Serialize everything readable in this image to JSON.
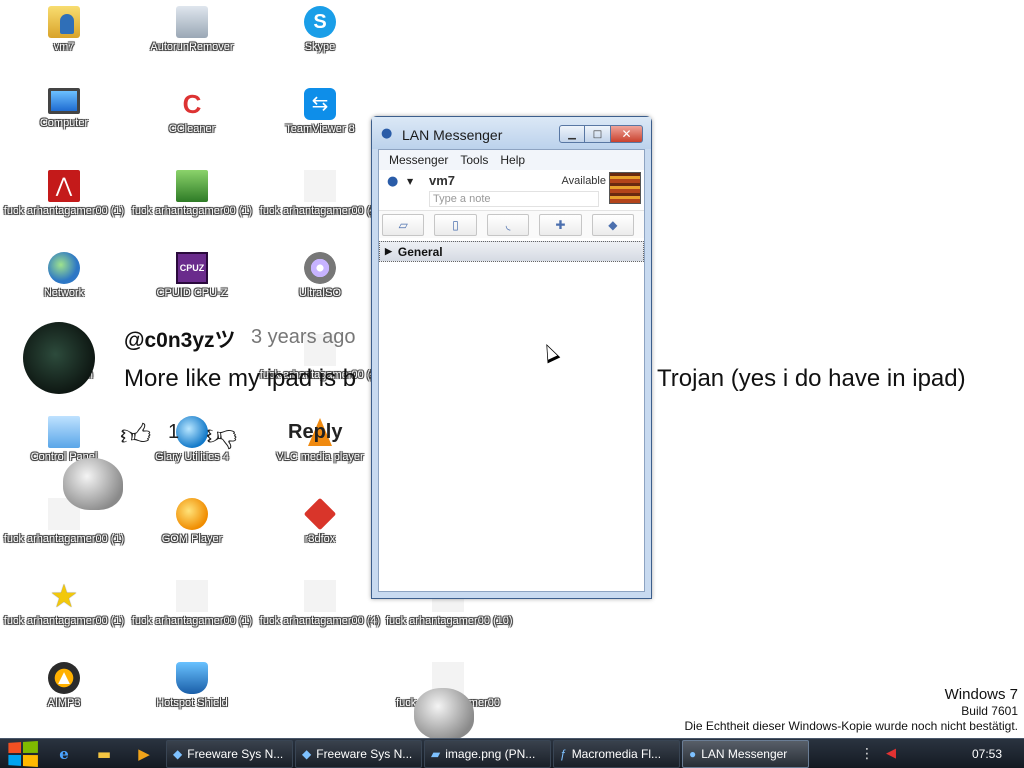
{
  "desktop_icons": [
    {
      "label": "vm7",
      "icon": "user-folder-icon"
    },
    {
      "label": "AutorunRemover",
      "icon": "autorun-remover-icon"
    },
    {
      "label": "Skype",
      "icon": "skype-icon",
      "glyph": "S"
    },
    {
      "label": "Computer",
      "icon": "computer-icon"
    },
    {
      "label": "CCleaner",
      "icon": "ccleaner-icon",
      "glyph": "C"
    },
    {
      "label": "TeamViewer 8",
      "icon": "teamviewer-icon",
      "glyph": "⇆"
    },
    {
      "label": "fuck arhantagamer00 (1)",
      "icon": "pdf-icon",
      "glyph": "⋀"
    },
    {
      "label": "fuck arhantagamer00 (1)",
      "icon": "script-icon"
    },
    {
      "label": "fuck arhantagamer00 (2)",
      "icon": "blank-file-icon"
    },
    {
      "label": "Network",
      "icon": "network-icon"
    },
    {
      "label": "CPUID CPU-Z",
      "icon": "cpuz-icon",
      "glyph": "CPUZ"
    },
    {
      "label": "UltraISO",
      "icon": "ultraiso-icon"
    },
    {
      "label": "Recycle Bin",
      "icon": "recycle-bin-icon"
    },
    {
      "label": "fuck arhantagamer00 (3)",
      "icon": "blank-file-icon"
    },
    {
      "label": "Control Panel",
      "icon": "control-panel-icon"
    },
    {
      "label": "Glary Utilities 4",
      "icon": "glary-utilities-icon"
    },
    {
      "label": "VLC media player",
      "icon": "vlc-icon"
    },
    {
      "label": "fuck arhantagamer00 (1)",
      "icon": "blank-file-icon"
    },
    {
      "label": "GOM Player",
      "icon": "gom-player-icon"
    },
    {
      "label": "r3dfox",
      "icon": "r3dfox-icon"
    },
    {
      "label": "fuck arhantagamer00 (1)",
      "icon": "star-icon",
      "glyph": "★"
    },
    {
      "label": "fuck arhantagamer00 (1)",
      "icon": "blank-file-icon"
    },
    {
      "label": "fuck arhantagamer00 (4)",
      "icon": "blank-file-icon"
    },
    {
      "label": "fuck arhantagamer00 (10)",
      "icon": "blank-file-icon"
    },
    {
      "label": "AIMP3",
      "icon": "aimp-icon",
      "glyph": "▲"
    },
    {
      "label": "Hotspot Shield",
      "icon": "hotspot-shield-icon"
    },
    {
      "label": "fuck arhantagamer00",
      "icon": "blank-file-icon"
    }
  ],
  "overlay": {
    "username": "@c0n3yzツ",
    "age": "3 years ago",
    "comment_start": "More like my ipad is b",
    "comment_end": "Trojan (yes i do have in ipad)",
    "likes": "1",
    "reply": "Reply"
  },
  "watermark": {
    "os": "Windows 7",
    "build": "Build 7601",
    "notice": "Die Echtheit dieser Windows-Kopie wurde noch nicht bestätigt."
  },
  "window": {
    "title": "LAN Messenger",
    "menu": [
      "Messenger",
      "Tools",
      "Help"
    ],
    "user": "vm7",
    "status": "Available",
    "note_placeholder": "Type a note",
    "toolbar": [
      {
        "icon": "eraser-icon",
        "glyph": "▱"
      },
      {
        "icon": "attachment-icon",
        "glyph": "▯"
      },
      {
        "icon": "broadcast-icon",
        "glyph": "◟"
      },
      {
        "icon": "add-contact-icon",
        "glyph": "✚"
      },
      {
        "icon": "settings-icon",
        "glyph": "◆"
      }
    ],
    "group": "General"
  },
  "taskbar": {
    "pinned": [
      {
        "icon": "internet-explorer-icon",
        "glyph": "e"
      },
      {
        "icon": "explorer-folder-icon",
        "glyph": "▬"
      },
      {
        "icon": "media-player-icon",
        "glyph": "▶"
      }
    ],
    "items": [
      {
        "label": "Freeware Sys N...",
        "icon": "freeware-icon",
        "glyph": "◆",
        "active": false
      },
      {
        "label": "Freeware Sys N...",
        "icon": "freeware-icon",
        "glyph": "◆",
        "active": false
      },
      {
        "label": "image.png (PN...",
        "icon": "image-viewer-icon",
        "glyph": "▰",
        "active": false
      },
      {
        "label": "Macromedia Fl...",
        "icon": "macromedia-icon",
        "glyph": "ƒ",
        "active": false
      },
      {
        "label": "LAN Messenger",
        "icon": "lan-messenger-icon",
        "glyph": "●",
        "active": true
      }
    ],
    "clock": "07:53"
  },
  "colors": {
    "titlebar": "#c8daf0",
    "close_button": "#c9412d",
    "taskbar": "#1c232d"
  }
}
